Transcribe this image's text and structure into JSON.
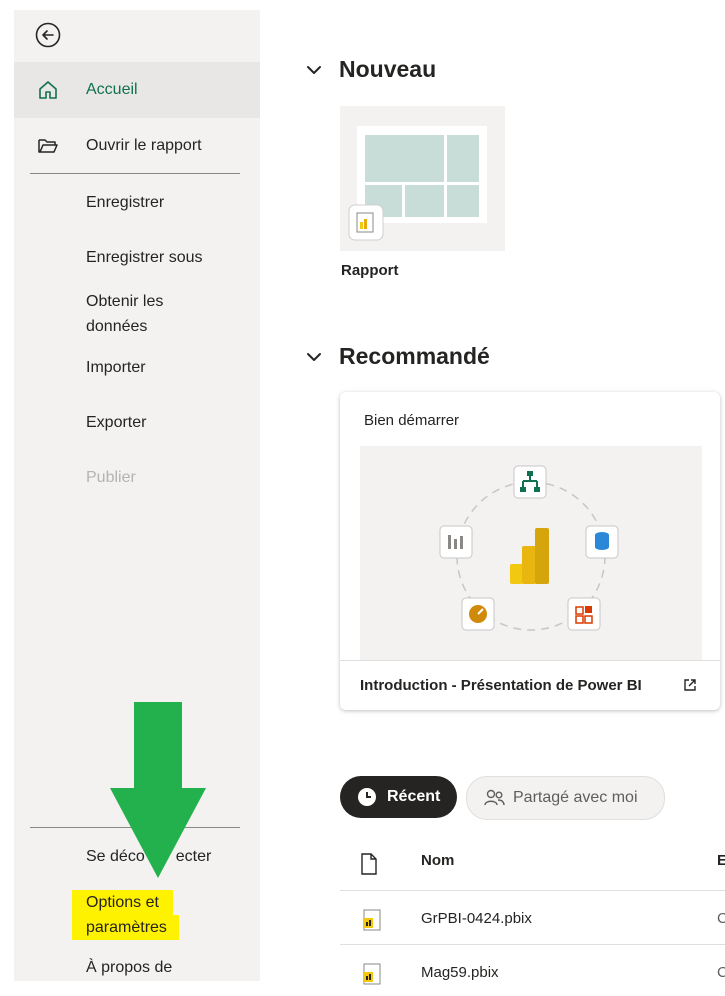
{
  "sidebar": {
    "items": [
      {
        "label": "Accueil",
        "icon": "home-icon"
      },
      {
        "label": "Ouvrir le rapport",
        "icon": "folder-open-icon"
      },
      {
        "label": "Enregistrer"
      },
      {
        "label": "Enregistrer sous"
      },
      {
        "label_line1": "Obtenir les",
        "label_line2": "données"
      },
      {
        "label": "Importer"
      },
      {
        "label": "Exporter"
      },
      {
        "label": "Publier"
      }
    ],
    "bottom": [
      {
        "label": "Se déconnecter",
        "partial_1": "Se déco",
        "partial_2": "ecter"
      },
      {
        "label_line1": "Options et",
        "label_line2": "paramètres"
      },
      {
        "label": "À propos de"
      }
    ]
  },
  "main": {
    "new_section": {
      "title": "Nouveau",
      "tile_label": "Rapport"
    },
    "recommended_section": {
      "title": "Recommandé",
      "card_title": "Bien démarrer",
      "card_footer": "Introduction - Présentation de Power BI"
    },
    "tabs": [
      {
        "label": "Récent",
        "icon": "clock-icon",
        "active": true
      },
      {
        "label": "Partagé avec moi",
        "icon": "people-icon",
        "active": false
      }
    ],
    "table": {
      "columns": [
        "Nom",
        "E"
      ],
      "rows": [
        {
          "name": "GrPBI-0424.pbix",
          "cut": "C"
        },
        {
          "name": "Mag59.pbix",
          "cut": "C"
        }
      ]
    }
  },
  "colors": {
    "accent": "#11704f",
    "highlight": "#fff200",
    "annotation_arrow": "#22b14c",
    "powerbi_yellow": "#f2c811"
  }
}
